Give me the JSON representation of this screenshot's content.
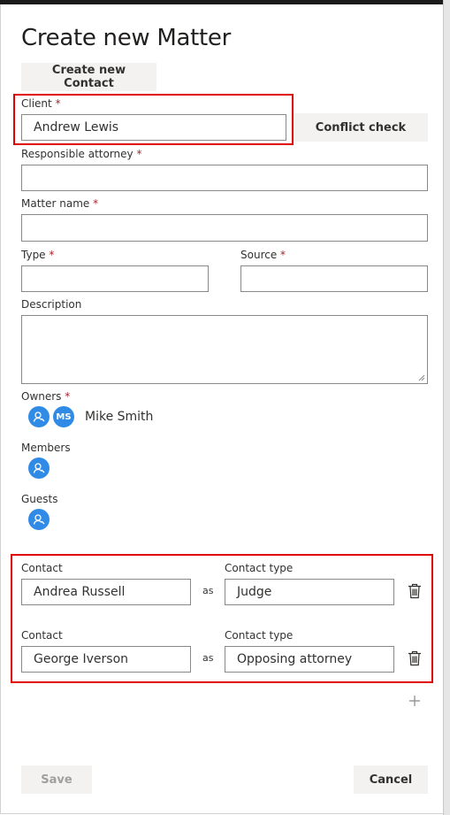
{
  "dialog": {
    "title": "Create new Matter"
  },
  "buttons": {
    "create_contact": "Create new Contact",
    "conflict_check": "Conflict check",
    "save": "Save",
    "cancel": "Cancel"
  },
  "fields": {
    "client": {
      "label": "Client",
      "required": "*",
      "value": "Andrew Lewis"
    },
    "responsible_attorney": {
      "label": "Responsible attorney",
      "required": "*",
      "value": ""
    },
    "matter_name": {
      "label": "Matter name",
      "required": "*",
      "value": ""
    },
    "type": {
      "label": "Type",
      "required": "*",
      "value": ""
    },
    "source": {
      "label": "Source",
      "required": "*",
      "value": ""
    },
    "description": {
      "label": "Description",
      "value": ""
    }
  },
  "owners": {
    "label": "Owners",
    "required": "*",
    "initials": "MS",
    "name": "Mike Smith"
  },
  "members": {
    "label": "Members"
  },
  "guests": {
    "label": "Guests"
  },
  "contacts": [
    {
      "contact_label": "Contact",
      "type_label": "Contact type",
      "name": "Andrea Russell",
      "as": "as",
      "type": "Judge"
    },
    {
      "contact_label": "Contact",
      "type_label": "Contact type",
      "name": "George Iverson",
      "as": "as",
      "type": "Opposing attorney"
    }
  ],
  "icons": {
    "avatar": "person-icon",
    "delete": "trash-icon",
    "add": "plus-icon"
  },
  "colors": {
    "accent": "#2f8be6",
    "required": "#a4262c",
    "highlight": "#e00000"
  }
}
